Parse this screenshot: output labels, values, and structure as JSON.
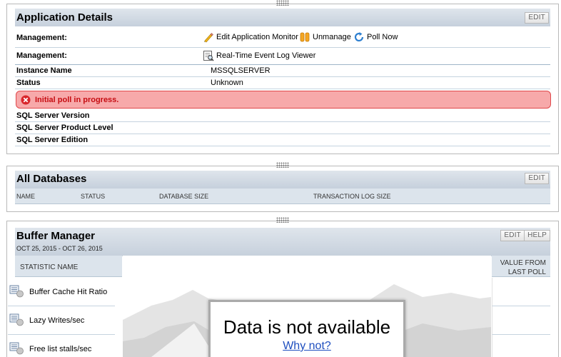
{
  "app_details": {
    "title": "Application Details",
    "edit_label": "EDIT",
    "management_label_1": "Management:",
    "management_label_2": "Management:",
    "edit_monitor_label": "Edit Application Monitor",
    "unmanage_label": "Unmanage",
    "poll_now_label": "Poll Now",
    "event_log_label": "Real-Time Event Log Viewer",
    "instance_name_label": "Instance Name",
    "instance_name_value": "MSSQLSERVER",
    "status_label": "Status",
    "status_value": "Unknown",
    "alert_text": "Initial poll in progress.",
    "sql_version_label": "SQL Server Version",
    "sql_product_level_label": "SQL Server Product Level",
    "sql_edition_label": "SQL Server Edition"
  },
  "all_databases": {
    "title": "All Databases",
    "edit_label": "EDIT",
    "columns": [
      "NAME",
      "STATUS",
      "DATABASE SIZE",
      "TRANSACTION LOG SIZE"
    ]
  },
  "buffer_manager": {
    "title": "Buffer Manager",
    "date_range": "OCT 25, 2015 - OCT 26, 2015",
    "edit_label": "EDIT",
    "help_label": "HELP",
    "col_statistic": "STATISTIC NAME",
    "col_value_line1": "VALUE FROM",
    "col_value_line2": "LAST POLL",
    "stats": [
      "Buffer Cache Hit Ratio",
      "Lazy Writes/sec",
      "Free list stalls/sec"
    ],
    "no_data_text": "Data is not available",
    "why_not_link": "Why not?"
  },
  "colors": {
    "header_bg": "#c9d3df",
    "alert_bg": "#f7a9aa",
    "alert_border": "#e0484b",
    "alert_text": "#c60d12",
    "link_blue": "#1f4fbf"
  }
}
